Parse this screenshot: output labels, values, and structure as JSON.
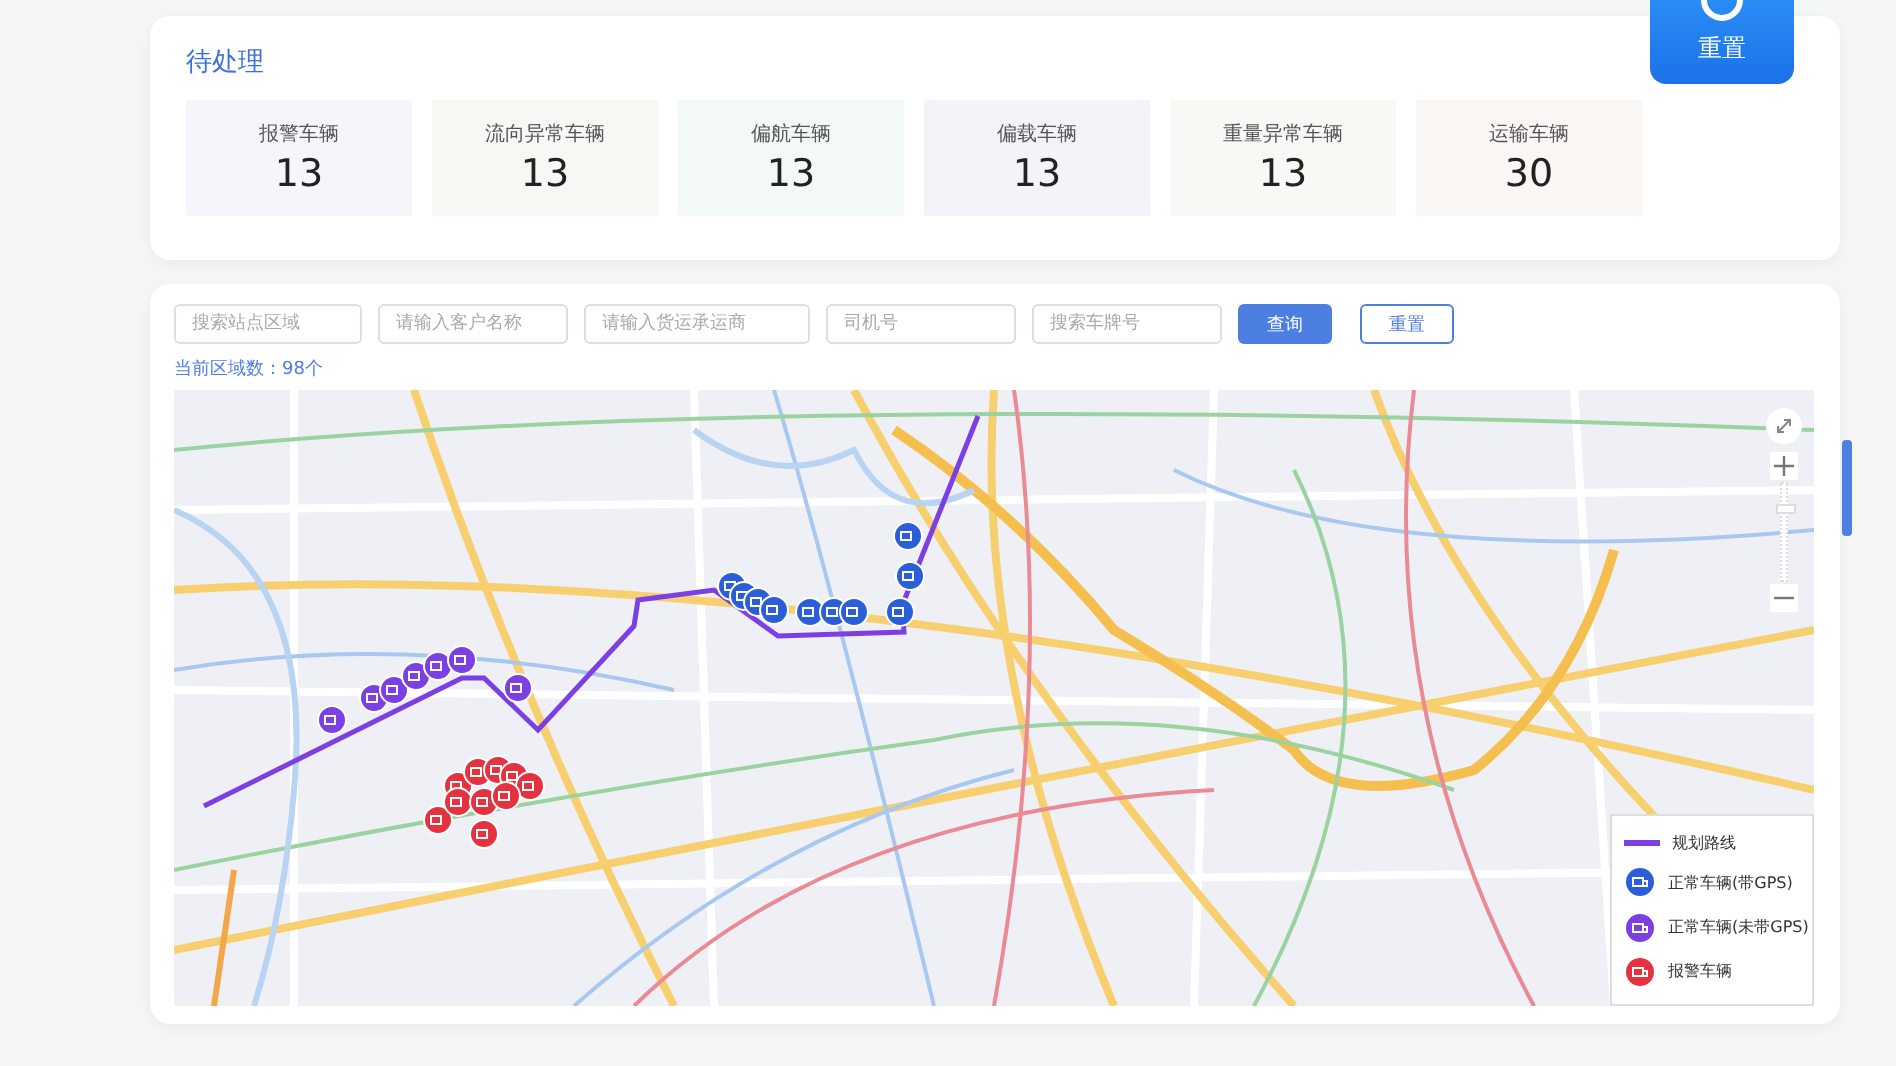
{
  "float_button": {
    "label": "重置"
  },
  "pending": {
    "title": "待处理",
    "cards": [
      {
        "label": "报警车辆",
        "value": "13",
        "color": "#f5f6fc"
      },
      {
        "label": "流向异常车辆",
        "value": "13",
        "color": "#f6f9f3"
      },
      {
        "label": "偏航车辆",
        "value": "13",
        "color": "#f3f9f9"
      },
      {
        "label": "偏载车辆",
        "value": "13",
        "color": "#f4f3f9"
      },
      {
        "label": "重量异常车辆",
        "value": "13",
        "color": "#f9f8f4"
      },
      {
        "label": "运输车辆",
        "value": "30",
        "color": "#faf6f3"
      }
    ]
  },
  "filters": {
    "fields": [
      {
        "placeholder": "搜索站点区域"
      },
      {
        "placeholder": "请输入客户名称"
      },
      {
        "placeholder": "请输入货运承运商"
      },
      {
        "placeholder": "司机号"
      },
      {
        "placeholder": "搜索车牌号"
      }
    ],
    "buttons": [
      {
        "label": "查询",
        "kind": "primary"
      },
      {
        "label": "重置",
        "kind": "plain"
      }
    ],
    "count": "当前区域数：98个"
  },
  "map_zoom": {
    "level": 0.75
  },
  "legend": [
    {
      "label": "规划路线",
      "kind": "route",
      "color": "#7b3fe4"
    },
    {
      "label": "正常车辆(带GPS)",
      "kind": "vehicle",
      "color": "#2b5fd9"
    },
    {
      "label": "正常车辆(未带GPS)",
      "kind": "vehicle",
      "color": "#7b3fe4"
    },
    {
      "label": "报警车辆",
      "kind": "vehicle",
      "color": "#e5323e"
    }
  ]
}
